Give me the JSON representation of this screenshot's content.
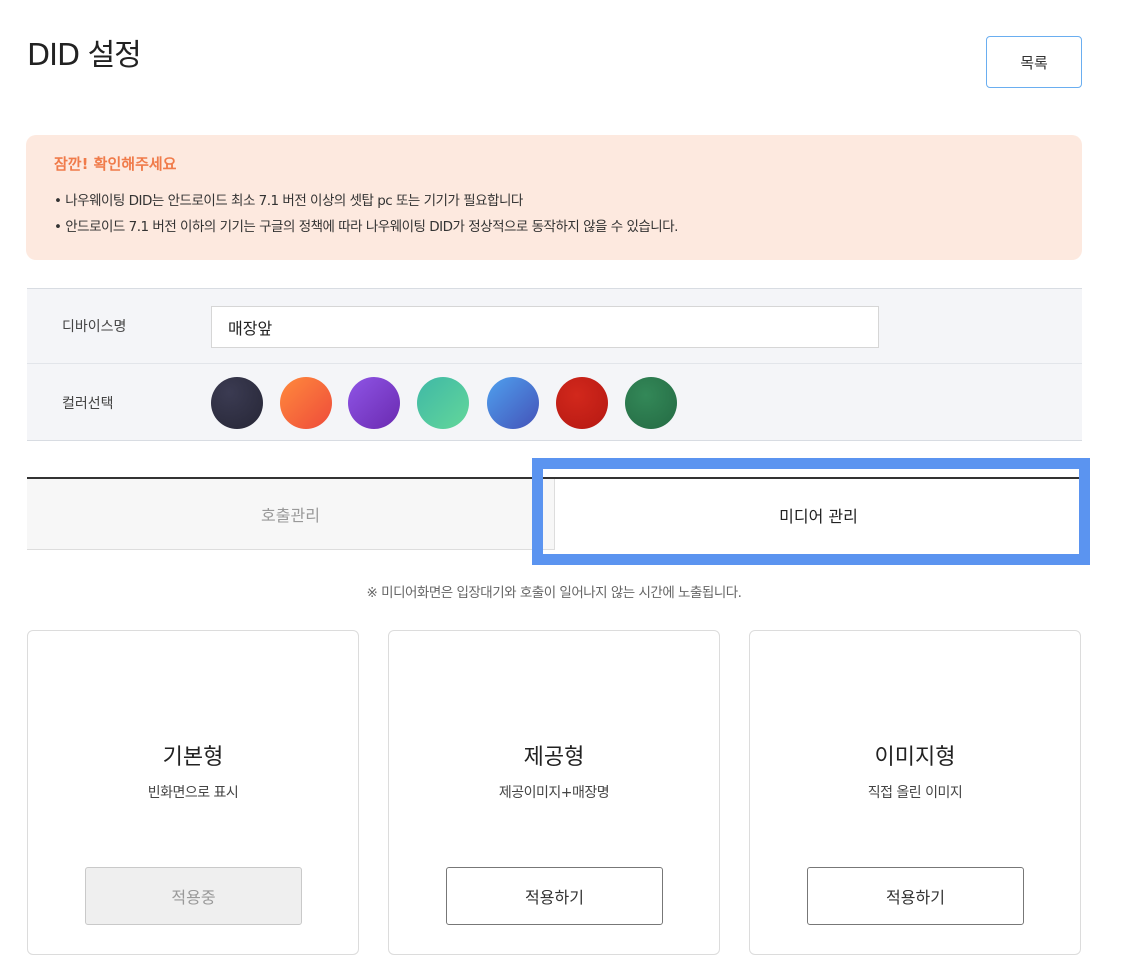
{
  "header": {
    "title": "DID 설정",
    "list_button": "목록"
  },
  "notice": {
    "title": "잠깐! 확인해주세요",
    "lines": [
      "• 나우웨이팅 DID는 안드로이드 최소 7.1 버전 이상의 셋탑 pc 또는 기기가 필요합니다",
      "• 안드로이드 7.1 버전 이하의 기기는 구글의 정책에 따라 나우웨이팅 DID가 정상적으로 동작하지 않을 수 있습니다."
    ]
  },
  "settings": {
    "device_name_label": "디바이스명",
    "device_name_value": "매장앞",
    "color_label": "컬러선택",
    "colors": [
      "#2f2f43",
      "#f36c3a",
      "#7b3fc4",
      "#4fc9a2",
      "#4f7fe0",
      "#c41f1a",
      "#2e7d4f"
    ]
  },
  "tabs": [
    {
      "label": "호출관리",
      "active": false
    },
    {
      "label": "미디어 관리",
      "active": true
    }
  ],
  "media_note": "※ 미디어화면은 입장대기와 호출이 일어나지 않는 시간에 노출됩니다.",
  "cards": [
    {
      "title": "기본형",
      "desc": "빈화면으로 표시",
      "button": "적용중"
    },
    {
      "title": "제공형",
      "desc": "제공이미지+매장명",
      "button": "적용하기"
    },
    {
      "title": "이미지형",
      "desc": "직접 올린 이미지",
      "button": "적용하기"
    }
  ]
}
